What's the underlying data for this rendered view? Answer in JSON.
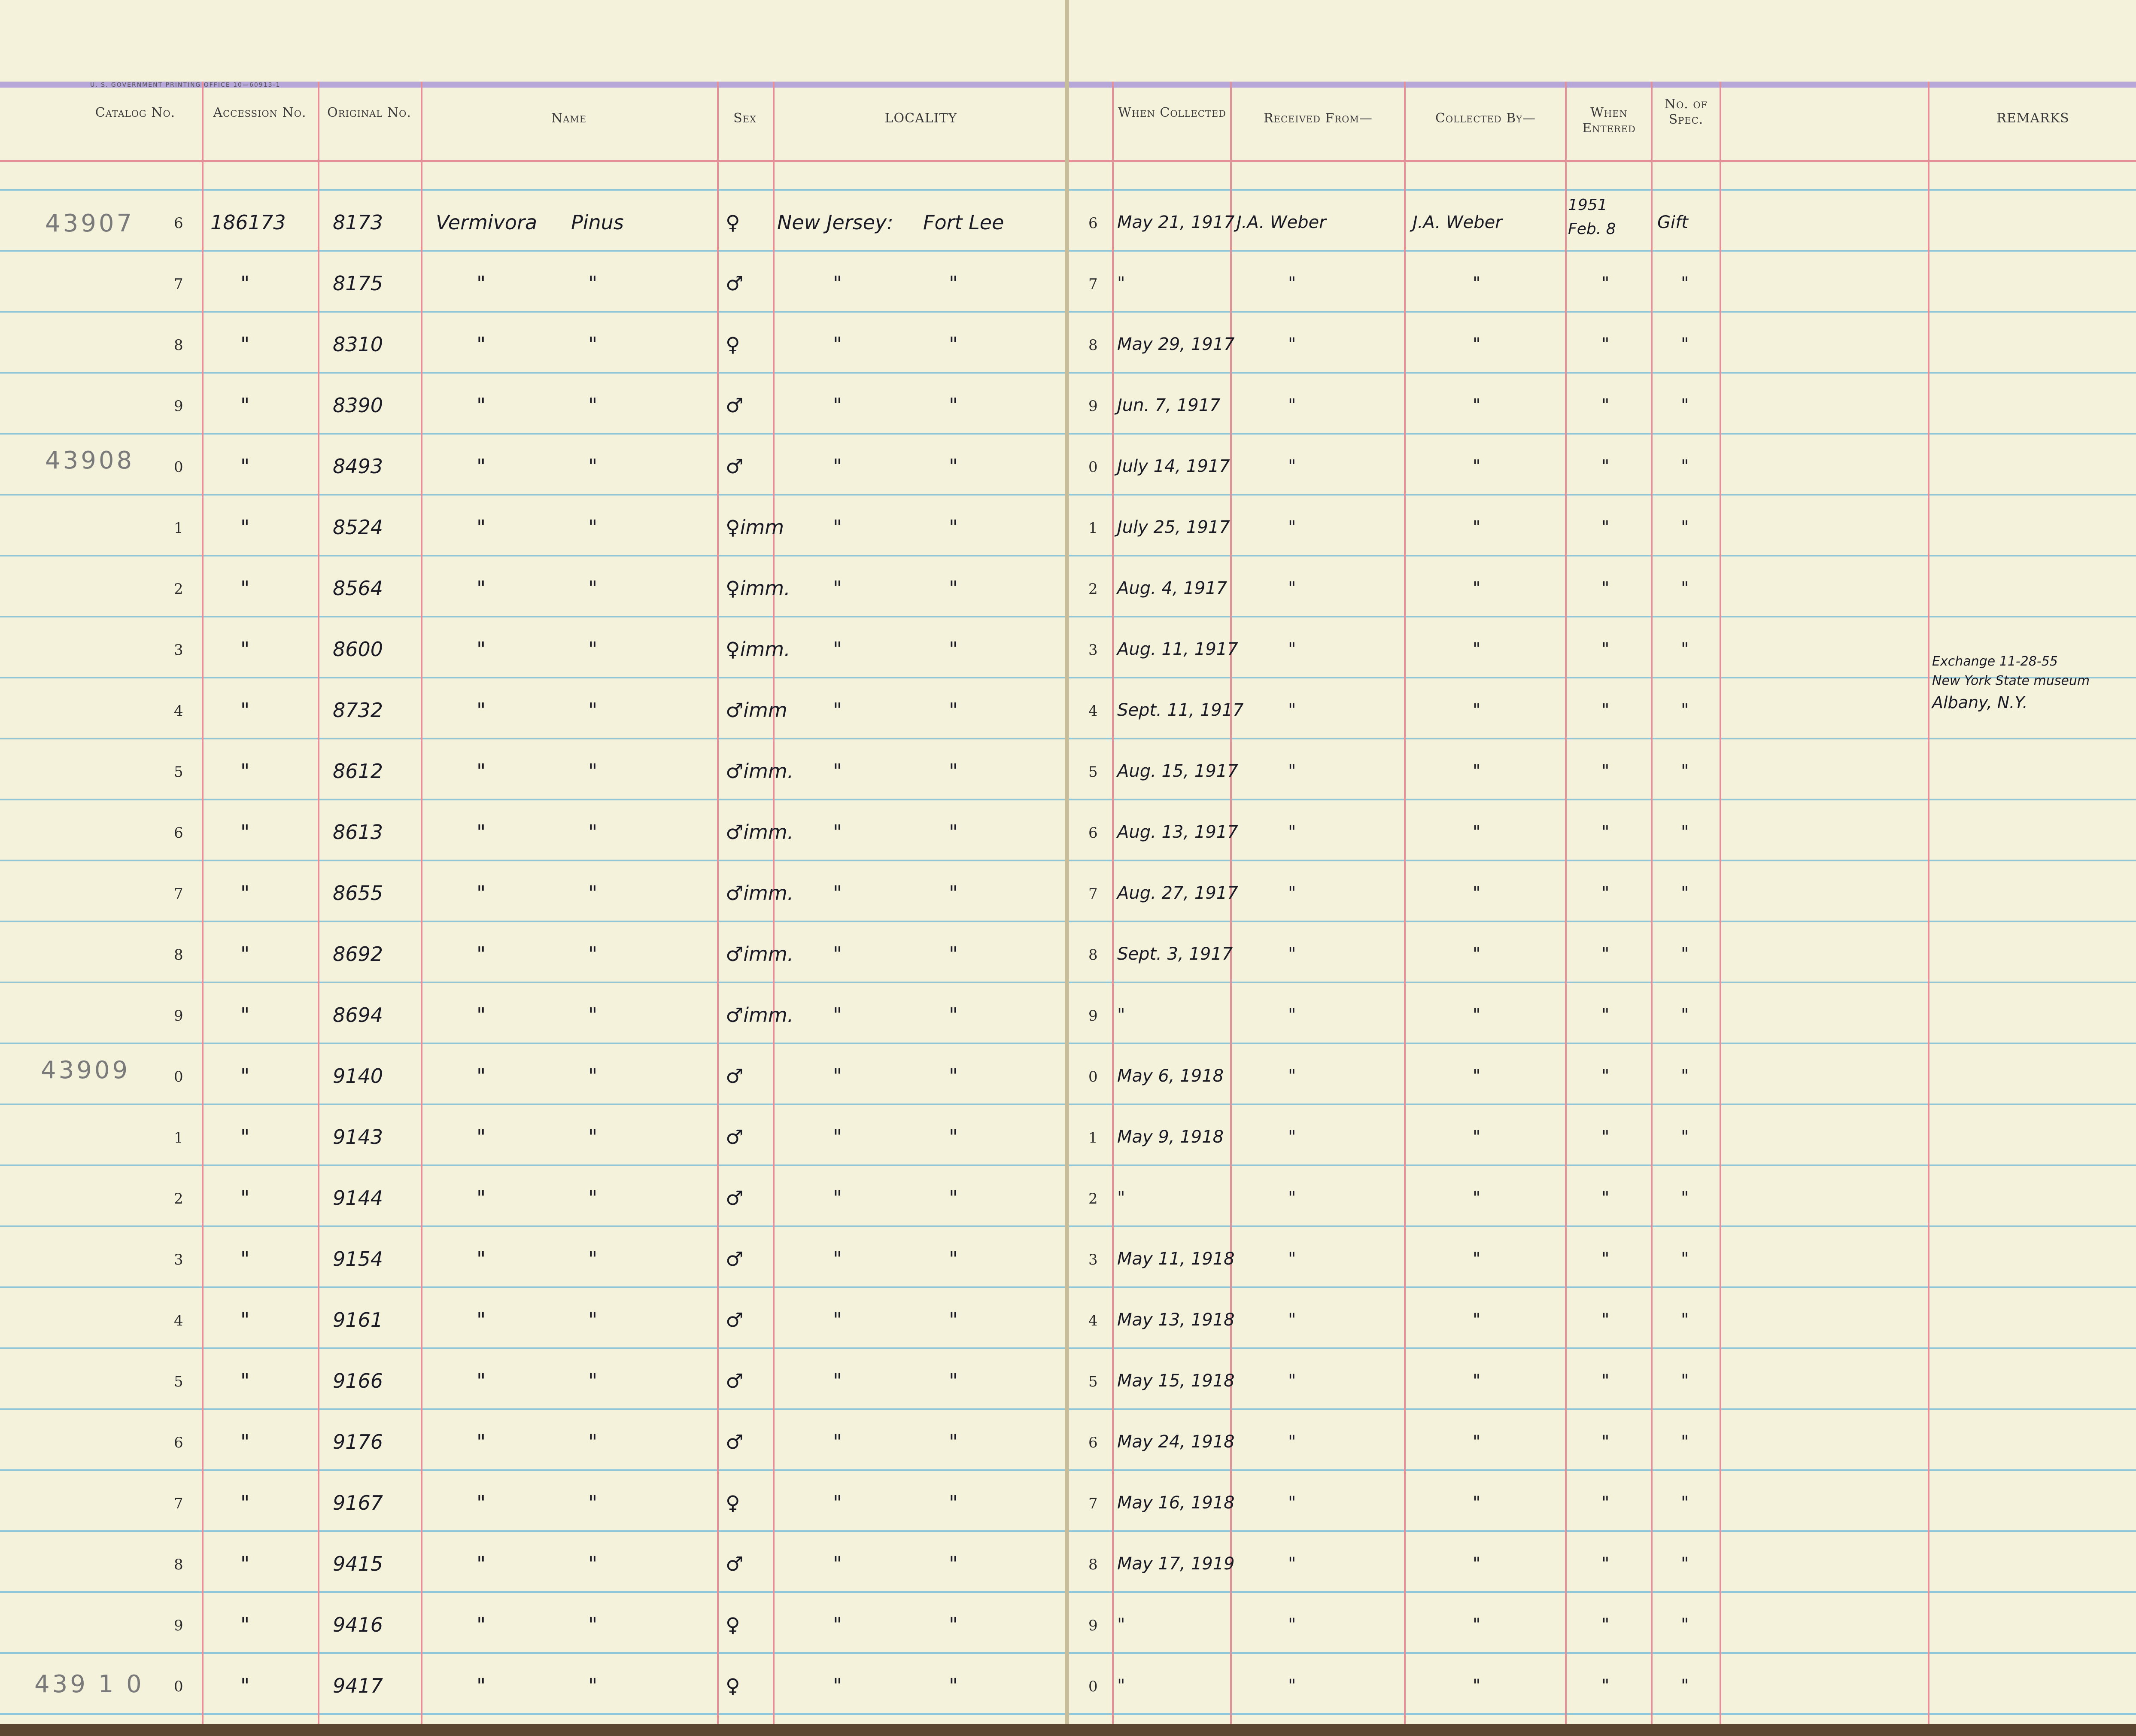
{
  "imprint": "U. S. GOVERNMENT PRINTING OFFICE    10—60913-1",
  "headers": {
    "catalog": "Catalog No.",
    "accession": "Accession No.",
    "original": "Original No.",
    "name": "Name",
    "sex": "Sex",
    "locality": "LOCALITY",
    "when_collected": "When Collected",
    "received_from": "Received From—",
    "collected_by": "Collected By—",
    "when_entered": "When Entered",
    "no_spec": "No. of Spec.",
    "remarks": "REMARKS"
  },
  "catalog_prefixes": [
    "43907",
    "43908",
    "43909",
    "439 1 0"
  ],
  "rows": [
    {
      "digit": "6",
      "accession": "186173",
      "original": "8173",
      "name1": "Vermivora",
      "name2": "Pinus",
      "sex": "♀",
      "loc1": "New Jersey:",
      "loc2": "Fort Lee",
      "collected": "May 21, 1917",
      "received": "J.A. Weber",
      "collector": "J.A. Weber",
      "entered": "1951 Feb. 8",
      "spec": "Gift"
    },
    {
      "digit": "7",
      "accession": "\"",
      "original": "8175",
      "name1": "\"",
      "name2": "\"",
      "sex": "♂",
      "loc1": "\"",
      "loc2": "\"",
      "collected": "\"",
      "received": "\"",
      "collector": "\"",
      "entered": "\"",
      "spec": "\""
    },
    {
      "digit": "8",
      "accession": "\"",
      "original": "8310",
      "name1": "\"",
      "name2": "\"",
      "sex": "♀",
      "loc1": "\"",
      "loc2": "\"",
      "collected": "May 29, 1917",
      "received": "\"",
      "collector": "\"",
      "entered": "\"",
      "spec": "\""
    },
    {
      "digit": "9",
      "accession": "\"",
      "original": "8390",
      "name1": "\"",
      "name2": "\"",
      "sex": "♂",
      "loc1": "\"",
      "loc2": "\"",
      "collected": "Jun. 7, 1917",
      "received": "\"",
      "collector": "\"",
      "entered": "\"",
      "spec": "\""
    },
    {
      "digit": "0",
      "accession": "\"",
      "original": "8493",
      "name1": "\"",
      "name2": "\"",
      "sex": "♂",
      "loc1": "\"",
      "loc2": "\"",
      "collected": "July 14, 1917",
      "received": "\"",
      "collector": "\"",
      "entered": "\"",
      "spec": "\""
    },
    {
      "digit": "1",
      "accession": "\"",
      "original": "8524",
      "name1": "\"",
      "name2": "\"",
      "sex": "♀imm",
      "loc1": "\"",
      "loc2": "\"",
      "collected": "July 25, 1917",
      "received": "\"",
      "collector": "\"",
      "entered": "\"",
      "spec": "\""
    },
    {
      "digit": "2",
      "accession": "\"",
      "original": "8564",
      "name1": "\"",
      "name2": "\"",
      "sex": "♀imm.",
      "loc1": "\"",
      "loc2": "\"",
      "collected": "Aug. 4, 1917",
      "received": "\"",
      "collector": "\"",
      "entered": "\"",
      "spec": "\""
    },
    {
      "digit": "3",
      "accession": "\"",
      "original": "8600",
      "name1": "\"",
      "name2": "\"",
      "sex": "♀imm.",
      "loc1": "\"",
      "loc2": "\"",
      "collected": "Aug. 11, 1917",
      "received": "\"",
      "collector": "\"",
      "entered": "\"",
      "spec": "\""
    },
    {
      "digit": "4",
      "accession": "\"",
      "original": "8732",
      "name1": "\"",
      "name2": "\"",
      "sex": "♂imm",
      "loc1": "\"",
      "loc2": "\"",
      "collected": "Sept. 11, 1917",
      "received": "\"",
      "collector": "\"",
      "entered": "\"",
      "spec": "\""
    },
    {
      "digit": "5",
      "accession": "\"",
      "original": "8612",
      "name1": "\"",
      "name2": "\"",
      "sex": "♂imm.",
      "loc1": "\"",
      "loc2": "\"",
      "collected": "Aug. 15, 1917",
      "received": "\"",
      "collector": "\"",
      "entered": "\"",
      "spec": "\""
    },
    {
      "digit": "6",
      "accession": "\"",
      "original": "8613",
      "name1": "\"",
      "name2": "\"",
      "sex": "♂imm.",
      "loc1": "\"",
      "loc2": "\"",
      "collected": "Aug. 13, 1917",
      "received": "\"",
      "collector": "\"",
      "entered": "\"",
      "spec": "\""
    },
    {
      "digit": "7",
      "accession": "\"",
      "original": "8655",
      "name1": "\"",
      "name2": "\"",
      "sex": "♂imm.",
      "loc1": "\"",
      "loc2": "\"",
      "collected": "Aug. 27, 1917",
      "received": "\"",
      "collector": "\"",
      "entered": "\"",
      "spec": "\""
    },
    {
      "digit": "8",
      "accession": "\"",
      "original": "8692",
      "name1": "\"",
      "name2": "\"",
      "sex": "♂imm.",
      "loc1": "\"",
      "loc2": "\"",
      "collected": "Sept. 3, 1917",
      "received": "\"",
      "collector": "\"",
      "entered": "\"",
      "spec": "\""
    },
    {
      "digit": "9",
      "accession": "\"",
      "original": "8694",
      "name1": "\"",
      "name2": "\"",
      "sex": "♂imm.",
      "loc1": "\"",
      "loc2": "\"",
      "collected": "\"",
      "received": "\"",
      "collector": "\"",
      "entered": "\"",
      "spec": "\""
    },
    {
      "digit": "0",
      "accession": "\"",
      "original": "9140",
      "name1": "\"",
      "name2": "\"",
      "sex": "♂",
      "loc1": "\"",
      "loc2": "\"",
      "collected": "May 6, 1918",
      "received": "\"",
      "collector": "\"",
      "entered": "\"",
      "spec": "\""
    },
    {
      "digit": "1",
      "accession": "\"",
      "original": "9143",
      "name1": "\"",
      "name2": "\"",
      "sex": "♂",
      "loc1": "\"",
      "loc2": "\"",
      "collected": "May 9, 1918",
      "received": "\"",
      "collector": "\"",
      "entered": "\"",
      "spec": "\""
    },
    {
      "digit": "2",
      "accession": "\"",
      "original": "9144",
      "name1": "\"",
      "name2": "\"",
      "sex": "♂",
      "loc1": "\"",
      "loc2": "\"",
      "collected": "\"",
      "received": "\"",
      "collector": "\"",
      "entered": "\"",
      "spec": "\""
    },
    {
      "digit": "3",
      "accession": "\"",
      "original": "9154",
      "name1": "\"",
      "name2": "\"",
      "sex": "♂",
      "loc1": "\"",
      "loc2": "\"",
      "collected": "May 11, 1918",
      "received": "\"",
      "collector": "\"",
      "entered": "\"",
      "spec": "\""
    },
    {
      "digit": "4",
      "accession": "\"",
      "original": "9161",
      "name1": "\"",
      "name2": "\"",
      "sex": "♂",
      "loc1": "\"",
      "loc2": "\"",
      "collected": "May 13, 1918",
      "received": "\"",
      "collector": "\"",
      "entered": "\"",
      "spec": "\""
    },
    {
      "digit": "5",
      "accession": "\"",
      "original": "9166",
      "name1": "\"",
      "name2": "\"",
      "sex": "♂",
      "loc1": "\"",
      "loc2": "\"",
      "collected": "May 15, 1918",
      "received": "\"",
      "collector": "\"",
      "entered": "\"",
      "spec": "\""
    },
    {
      "digit": "6",
      "accession": "\"",
      "original": "9176",
      "name1": "\"",
      "name2": "\"",
      "sex": "♂",
      "loc1": "\"",
      "loc2": "\"",
      "collected": "May 24, 1918",
      "received": "\"",
      "collector": "\"",
      "entered": "\"",
      "spec": "\""
    },
    {
      "digit": "7",
      "accession": "\"",
      "original": "9167",
      "name1": "\"",
      "name2": "\"",
      "sex": "♀",
      "loc1": "\"",
      "loc2": "\"",
      "collected": "May 16, 1918",
      "received": "\"",
      "collector": "\"",
      "entered": "\"",
      "spec": "\""
    },
    {
      "digit": "8",
      "accession": "\"",
      "original": "9415",
      "name1": "\"",
      "name2": "\"",
      "sex": "♂",
      "loc1": "\"",
      "loc2": "\"",
      "collected": "May 17, 1919",
      "received": "\"",
      "collector": "\"",
      "entered": "\"",
      "spec": "\""
    },
    {
      "digit": "9",
      "accession": "\"",
      "original": "9416",
      "name1": "\"",
      "name2": "\"",
      "sex": "♀",
      "loc1": "\"",
      "loc2": "\"",
      "collected": "\"",
      "received": "\"",
      "collector": "\"",
      "entered": "\"",
      "spec": "\""
    },
    {
      "digit": "0",
      "accession": "\"",
      "original": "9417",
      "name1": "\"",
      "name2": "\"",
      "sex": "♀",
      "loc1": "\"",
      "loc2": "\"",
      "collected": "\"",
      "received": "\"",
      "collector": "\"",
      "entered": "\"",
      "spec": "\""
    }
  ],
  "remark": {
    "line1": "Exchange 11-28-55",
    "line2": "New York State museum",
    "line3": "Albany, N.Y."
  },
  "colors": {
    "paper": "#f5f2dc",
    "rule_blue": "#8fc6d8",
    "rule_red": "#e58f98",
    "band_purple": "#b7a7d9",
    "ink": "#1b1b26"
  }
}
